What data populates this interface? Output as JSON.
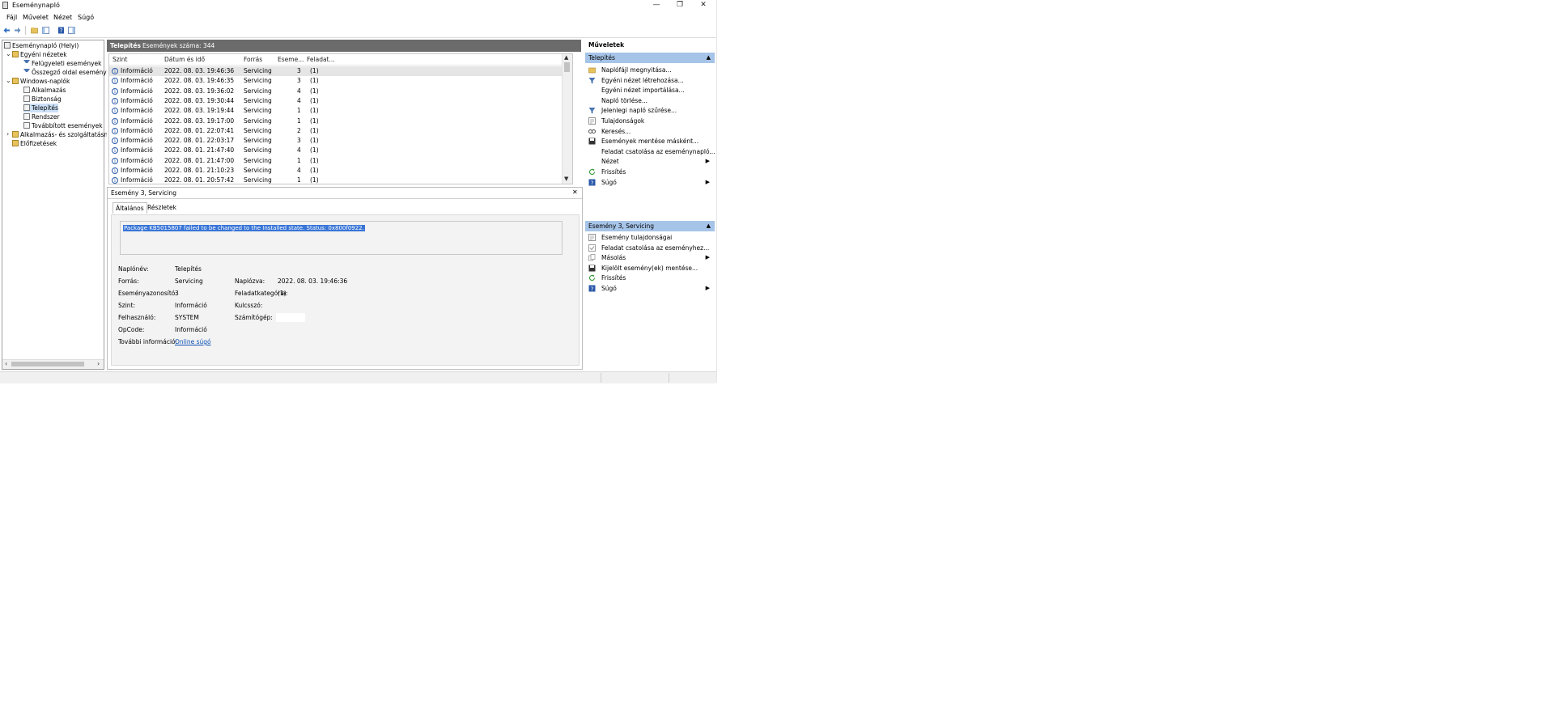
{
  "window": {
    "title": "Eseménynapló",
    "controls": {
      "minimize": "—",
      "restore": "❐",
      "close": "✕"
    }
  },
  "menu": [
    "Fájl",
    "Művelet",
    "Nézet",
    "Súgó"
  ],
  "tree": {
    "root": "Eseménynapló (Helyi)",
    "custom_views": "Egyéni nézetek",
    "admin_events": "Felügyeleti események",
    "summary": "Összegző oldal eseménye",
    "windows_logs": "Windows-naplók",
    "application": "Alkalmazás",
    "security": "Biztonság",
    "setup": "Telepítés",
    "system": "Rendszer",
    "forwarded": "Továbbított események",
    "apps_services": "Alkalmazás- és szolgáltatásn",
    "subscriptions": "Előfizetések"
  },
  "events": {
    "header_title": "Telepítés",
    "header_count": "Események száma: 344",
    "columns": [
      "Szint",
      "Dátum és idő",
      "Forrás",
      "Eseme...",
      "Feladat..."
    ],
    "rows": [
      {
        "level": "Információ",
        "date": "2022. 08. 03. 19:46:36",
        "source": "Servicing",
        "id": "3",
        "task": "(1)"
      },
      {
        "level": "Információ",
        "date": "2022. 08. 03. 19:46:35",
        "source": "Servicing",
        "id": "3",
        "task": "(1)"
      },
      {
        "level": "Információ",
        "date": "2022. 08. 03. 19:36:02",
        "source": "Servicing",
        "id": "4",
        "task": "(1)"
      },
      {
        "level": "Információ",
        "date": "2022. 08. 03. 19:30:44",
        "source": "Servicing",
        "id": "4",
        "task": "(1)"
      },
      {
        "level": "Információ",
        "date": "2022. 08. 03. 19:19:44",
        "source": "Servicing",
        "id": "1",
        "task": "(1)"
      },
      {
        "level": "Információ",
        "date": "2022. 08. 03. 19:17:00",
        "source": "Servicing",
        "id": "1",
        "task": "(1)"
      },
      {
        "level": "Információ",
        "date": "2022. 08. 01. 22:07:41",
        "source": "Servicing",
        "id": "2",
        "task": "(1)"
      },
      {
        "level": "Információ",
        "date": "2022. 08. 01. 22:03:17",
        "source": "Servicing",
        "id": "3",
        "task": "(1)"
      },
      {
        "level": "Információ",
        "date": "2022. 08. 01. 21:47:40",
        "source": "Servicing",
        "id": "4",
        "task": "(1)"
      },
      {
        "level": "Információ",
        "date": "2022. 08. 01. 21:47:00",
        "source": "Servicing",
        "id": "1",
        "task": "(1)"
      },
      {
        "level": "Információ",
        "date": "2022. 08. 01. 21:10:23",
        "source": "Servicing",
        "id": "4",
        "task": "(1)"
      },
      {
        "level": "Információ",
        "date": "2022. 08. 01. 20:57:42",
        "source": "Servicing",
        "id": "1",
        "task": "(1)"
      }
    ]
  },
  "detail": {
    "title": "Esemény 3, Servicing",
    "close": "✕",
    "tab_general": "Általános",
    "tab_details": "Részletek",
    "message": "Package KB5015807 failed to be changed to the Installed state. Status: 0x800f0922.",
    "labels": {
      "log_name": "Naplónév:",
      "source": "Forrás:",
      "event_id": "Eseményazonosító:",
      "level": "Szint:",
      "user": "Felhasználó:",
      "opcode": "OpCode:",
      "more_info": "További információ:",
      "logged": "Naplózva:",
      "task_category": "Feladatkategória:",
      "keywords": "Kulcsszó:",
      "computer": "Számítógép:"
    },
    "values": {
      "log_name": "Telepítés",
      "source": "Servicing",
      "event_id": "3",
      "level": "Információ",
      "user": "SYSTEM",
      "opcode": "Információ",
      "more_info": "Online súgó",
      "logged": "2022. 08. 03. 19:46:36",
      "task_category": "(1)",
      "keywords": ""
    }
  },
  "actions": {
    "title": "Műveletek",
    "section1": "Telepítés",
    "items1": [
      {
        "label": "Naplófájl megnyitása...",
        "icon": "folder-icon",
        "arrow": false
      },
      {
        "label": "Egyéni nézet létrehozása...",
        "icon": "filter-icon",
        "arrow": false
      },
      {
        "label": "Egyéni nézet importálása...",
        "icon": "",
        "arrow": false
      },
      {
        "label": "Napló törlése...",
        "icon": "",
        "arrow": false
      },
      {
        "label": "Jelenlegi napló szűrése...",
        "icon": "filter-icon",
        "arrow": false
      },
      {
        "label": "Tulajdonságok",
        "icon": "properties-icon",
        "arrow": false
      },
      {
        "label": "Keresés...",
        "icon": "find-icon",
        "arrow": false
      },
      {
        "label": "Események mentése másként...",
        "icon": "save-icon",
        "arrow": false
      },
      {
        "label": "Feladat csatolása az eseménynapló...",
        "icon": "",
        "arrow": false
      },
      {
        "label": "Nézet",
        "icon": "",
        "arrow": true
      },
      {
        "label": "Frissítés",
        "icon": "refresh-icon",
        "arrow": false
      },
      {
        "label": "Súgó",
        "icon": "help-icon",
        "arrow": true
      }
    ],
    "section2": "Esemény 3, Servicing",
    "items2": [
      {
        "label": "Esemény tulajdonságai",
        "icon": "properties-icon",
        "arrow": false
      },
      {
        "label": "Feladat csatolása az eseményhez...",
        "icon": "task-icon",
        "arrow": false
      },
      {
        "label": "Másolás",
        "icon": "copy-icon",
        "arrow": true
      },
      {
        "label": "Kijelölt esemény(ek) mentése...",
        "icon": "save-icon",
        "arrow": false
      },
      {
        "label": "Frissítés",
        "icon": "refresh-icon",
        "arrow": false
      },
      {
        "label": "Súgó",
        "icon": "help-icon",
        "arrow": true
      }
    ]
  },
  "colors": {
    "header_bg": "#6b6b6b",
    "actions_section_bg": "#a6c4e8",
    "selection": "#3875d7",
    "link": "#0b4fb3"
  }
}
